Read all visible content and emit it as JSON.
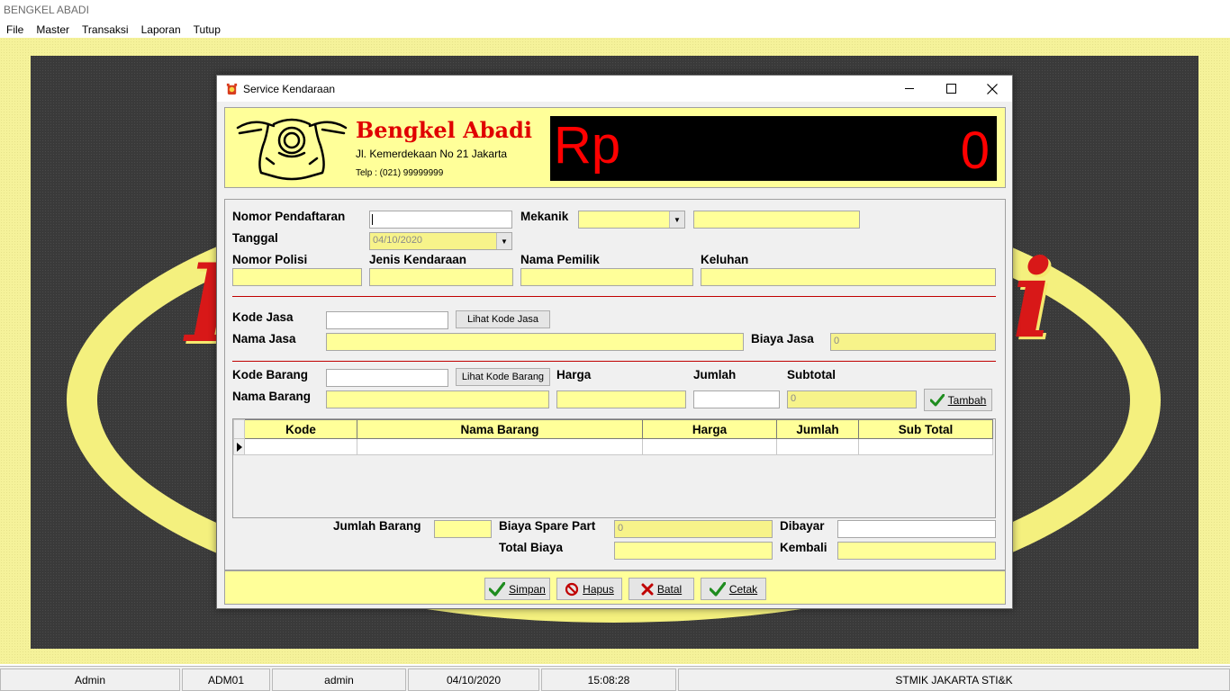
{
  "app": {
    "title": "BENGKEL ABADI"
  },
  "menu": [
    "File",
    "Master",
    "Transaksi",
    "Laporan",
    "Tutup"
  ],
  "dialog": {
    "title": "Service Kendaraan"
  },
  "header": {
    "company": "Bengkel Abadi",
    "address": "Jl. Kemerdekaan No 21 Jakarta",
    "phone": "Telp : (021) 99999999",
    "currency": "Rp",
    "amount": "0"
  },
  "form": {
    "nomor_pendaftaran_label": "Nomor Pendaftaran",
    "nomor_pendaftaran_value": "",
    "mekanik_label": "Mekanik",
    "tanggal_label": "Tanggal",
    "tanggal_value": "04/10/2020",
    "nomor_polisi_label": "Nomor Polisi",
    "jenis_kendaraan_label": "Jenis Kendaraan",
    "nama_pemilik_label": "Nama Pemilik",
    "keluhan_label": "Keluhan",
    "kode_jasa_label": "Kode Jasa",
    "lihat_kode_jasa_button": "Lihat Kode Jasa",
    "nama_jasa_label": "Nama Jasa",
    "biaya_jasa_label": "Biaya Jasa",
    "biaya_jasa_value": "0",
    "kode_barang_label": "Kode Barang",
    "lihat_kode_barang_button": "Lihat Kode Barang",
    "harga_label": "Harga",
    "jumlah_label": "Jumlah",
    "subtotal_label": "Subtotal",
    "subtotal_value": "0",
    "nama_barang_label": "Nama Barang",
    "tambah_button": "Tambah",
    "jumlah_barang_label": "Jumlah Barang",
    "biaya_spare_part_label": "Biaya Spare Part",
    "biaya_spare_part_value": "0",
    "dibayar_label": "Dibayar",
    "total_biaya_label": "Total Biaya",
    "kembali_label": "Kembali"
  },
  "grid": {
    "columns": [
      "Kode",
      "Nama Barang",
      "Harga",
      "Jumlah",
      "Sub Total"
    ]
  },
  "buttons": {
    "simpan": "Simpan",
    "hapus": "Hapus",
    "batal": "Batal",
    "cetak": "Cetak"
  },
  "status": [
    "Admin",
    "ADM01",
    "admin",
    "04/10/2020",
    "15:08:28",
    "STMIK JAKARTA STI&K"
  ],
  "colors": {
    "accent_yellow": "#ffff99",
    "brand_red": "#e00000",
    "display_bg": "#000000"
  }
}
